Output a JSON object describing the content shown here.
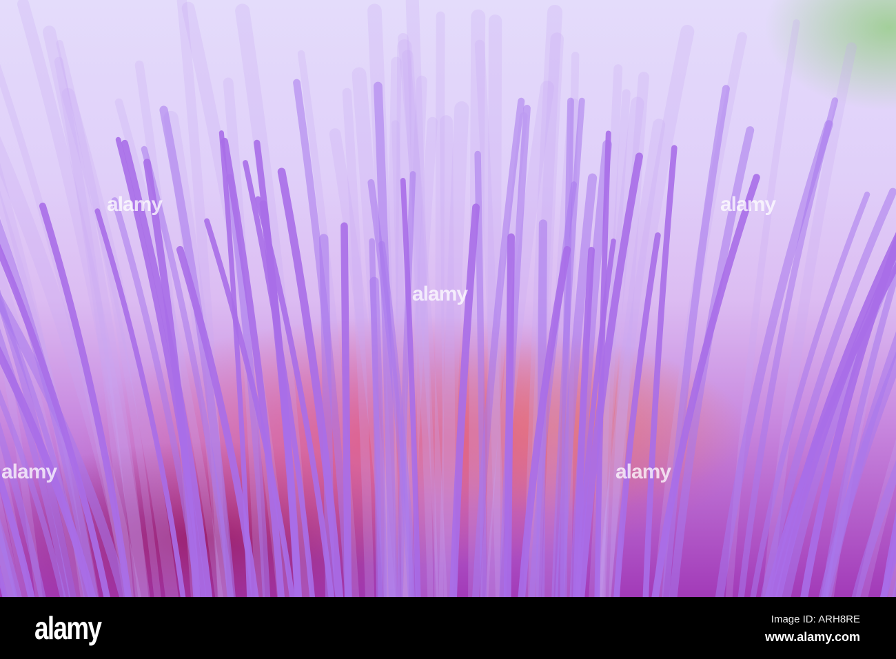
{
  "photo": {
    "subject": "purple thistle flower filaments",
    "watermark_text": "alamy",
    "colors": {
      "sky": "#e2d6fa",
      "filament": "#a86ee8",
      "center": "#c0307e",
      "warm": "#f09a5a"
    }
  },
  "footer": {
    "logo": "alamy",
    "image_id": "Image ID: ARH8RE",
    "website": "www.alamy.com"
  }
}
